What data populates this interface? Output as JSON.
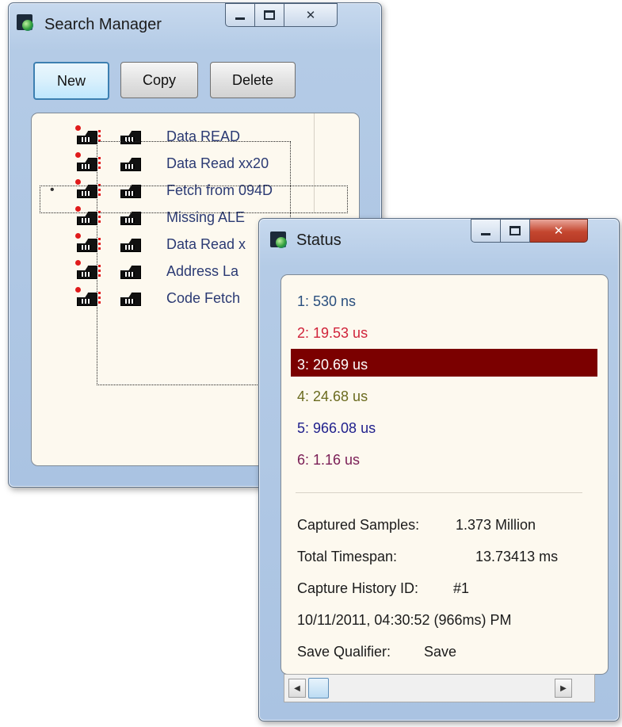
{
  "search_manager": {
    "title": "Search Manager",
    "buttons": {
      "new": "New",
      "copy": "Copy",
      "delete": "Delete"
    },
    "searches": [
      {
        "label": "Data READ",
        "selected": false
      },
      {
        "label": "Data Read xx20",
        "selected": false
      },
      {
        "label": "Fetch from 094D",
        "selected": true
      },
      {
        "label": "Missing ALE",
        "selected": false
      },
      {
        "label": "Data Read x",
        "selected": false
      },
      {
        "label": "Address La",
        "selected": false
      },
      {
        "label": "Code Fetch",
        "selected": false
      }
    ],
    "selected_marker": "•"
  },
  "status": {
    "title": "Status",
    "timings": [
      {
        "label": "1:  530 ns",
        "color": "#2a4f7e"
      },
      {
        "label": "2:  19.53 us",
        "color": "#d0233a"
      },
      {
        "label": "3:  20.69 us",
        "color": "#ffffff",
        "highlight": "#7b0000"
      },
      {
        "label": "4:  24.68 us",
        "color": "#6b6b1f"
      },
      {
        "label": "5:  966.08 us",
        "color": "#1f1f8c"
      },
      {
        "label": "6:  1.16 us",
        "color": "#7a1d55"
      }
    ],
    "info": {
      "captured_samples_label": "Captured Samples:",
      "captured_samples_value": "1.373 Million",
      "total_timespan_label": "Total Timespan:",
      "total_timespan_value": "13.73413 ms",
      "capture_history_label": "Capture History ID:",
      "capture_history_value": "#1",
      "timestamp": "10/11/2011, 04:30:52 (966ms) PM",
      "save_qualifier_label": "Save Qualifier:",
      "save_qualifier_value": "Save"
    }
  },
  "icons": {
    "app": "app-logo-icon",
    "search_enable": "search-enable-icon",
    "search_edit": "search-edit-icon",
    "minimize": "minimize-icon",
    "maximize": "maximize-icon",
    "close": "close-icon"
  }
}
